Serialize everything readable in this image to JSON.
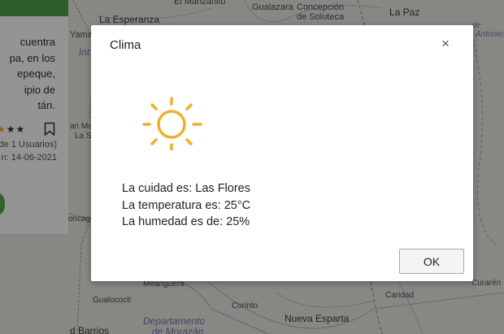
{
  "map": {
    "places": {
      "la_esperanza": "La Esperanza",
      "el_manzanito": "El Manzanito",
      "gualazara": "Gualazara",
      "concepcion_line1": "Concepción",
      "concepcion_line2": "de Soluteca",
      "la_paz": "La Paz",
      "yamar": "Yamar",
      "int": "Int",
      "antonio_line1": "de",
      "antonio_line2": "Antonio",
      "san_ma_line1": "an Ma",
      "san_ma_line2": "La S",
      "concagua": "oncagüe",
      "magua": "Meanguera",
      "gualococti": "Gualococti",
      "corinto": "Corinto",
      "caridad": "Caridad",
      "curaren": "Curarén",
      "nueva_esparta": "Nueva Esparta",
      "departamento_line1": "Departamento",
      "departamento_line2": "de Morazán",
      "del_barrios": "d Barrios"
    }
  },
  "card": {
    "text_lines": [
      "cuentra",
      "pa, en los",
      "epeque,",
      "ipio de",
      "tán."
    ],
    "stars_gold": "★",
    "stars_dark": "★★",
    "rating_text": "de 1 Usuarios)",
    "date_text": "n: 14-06-2021",
    "bookmark_icon": "bookmark-icon"
  },
  "modal": {
    "title": "Clima",
    "close_glyph": "×",
    "icon": "sun-icon",
    "lines": {
      "city": "La cuidad es: Las Flores",
      "temperature": "La temperatura es: 25°C",
      "humidity": "La humedad es de: 25%"
    },
    "ok_label": "OK"
  },
  "colors": {
    "sun": "#f0ae2b",
    "card_green": "#4ea24b",
    "overlay": "rgba(0,0,0,0.42)"
  }
}
